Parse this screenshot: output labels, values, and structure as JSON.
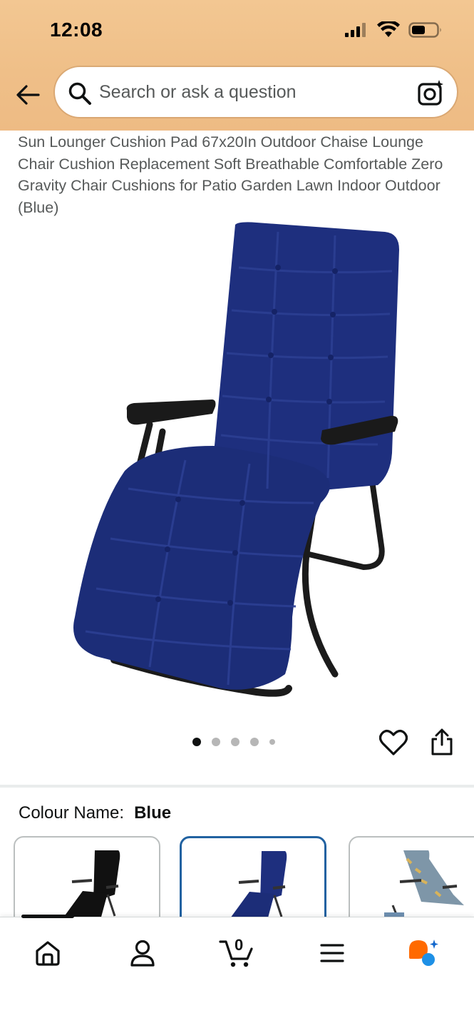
{
  "status_bar": {
    "time": "12:08"
  },
  "search": {
    "placeholder": "Search or ask a question"
  },
  "product": {
    "title": "Sun Lounger Cushion Pad 67x20In Outdoor Chaise Lounge Chair Cushion Replacement Soft Breathable Comfortable Zero Gravity Chair Cushions for Patio Garden Lawn Indoor Outdoor (Blue)",
    "carousel": {
      "total_dots": 5,
      "active_index": 0
    }
  },
  "variation": {
    "label": "Colour Name:",
    "selected_value": "Blue",
    "swatches": [
      "black",
      "blue",
      "floral"
    ],
    "selected_index": 1
  },
  "cart": {
    "count": "0"
  },
  "colors": {
    "header_bg": "#f0c08a",
    "accent_blue": "#2162a1",
    "cushion_navy": "#1c2d78"
  },
  "icons": [
    "back-arrow-icon",
    "search-icon",
    "camera-lens-icon",
    "heart-icon",
    "share-icon",
    "home-icon",
    "profile-icon",
    "cart-icon",
    "menu-icon",
    "rufus-assistant-icon"
  ]
}
